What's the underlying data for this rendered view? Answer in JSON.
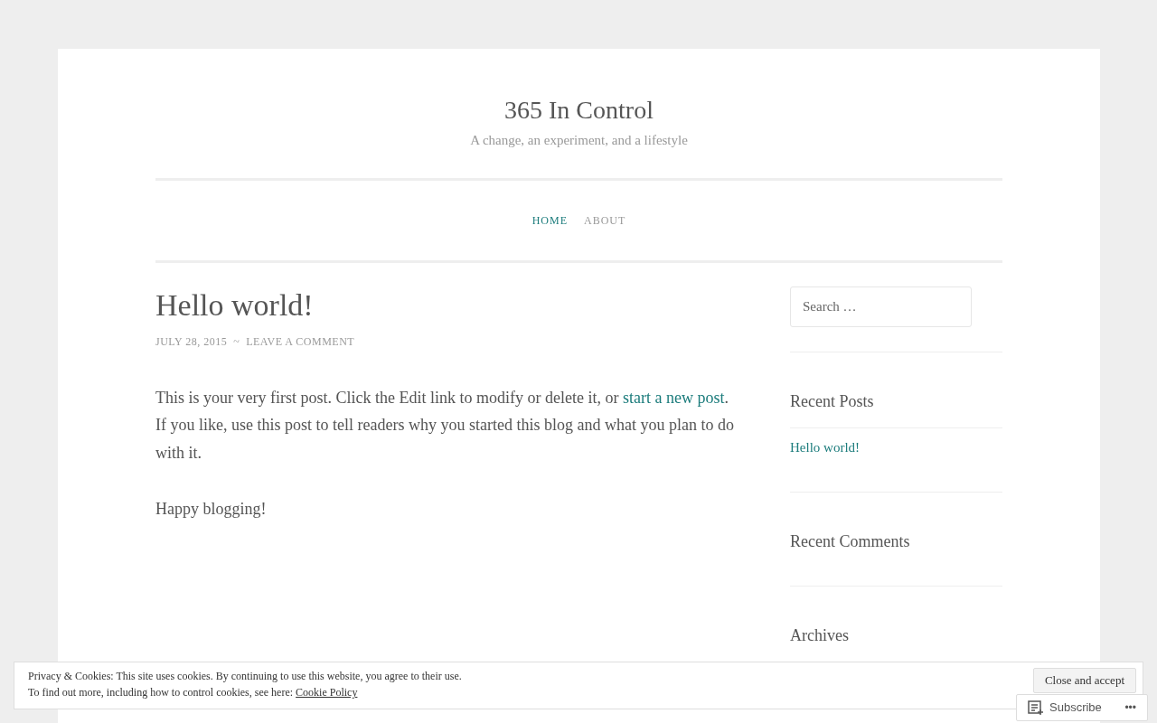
{
  "site": {
    "title": "365 In Control",
    "tagline": "A change, an experiment, and a lifestyle"
  },
  "nav": [
    {
      "label": "HOME",
      "selected": true
    },
    {
      "label": "ABOUT",
      "selected": false
    }
  ],
  "post": {
    "title": "Hello world!",
    "date": "JULY 28, 2015",
    "separator": "~",
    "comment_link": "LEAVE A COMMENT",
    "paragraphs": [
      {
        "before": "This is your very first post. Click the Edit link to modify or delete it, or ",
        "link": "start a new post",
        "after": ". If you like, use this post to tell readers why you started this blog and what you plan to do with it."
      },
      {
        "before": "Happy blogging!"
      }
    ]
  },
  "sidebar": {
    "search": {
      "placeholder": "Search …"
    },
    "widgets": [
      {
        "title": "Recent Posts",
        "links": [
          "Hello world!"
        ]
      },
      {
        "title": "Recent Comments"
      },
      {
        "title": "Archives"
      }
    ]
  },
  "cookie_bar": {
    "line1": "Privacy & Cookies: This site uses cookies. By continuing to use this website, you agree to their use.",
    "line2": "To find out more, including how to control cookies, see here: ",
    "policy_link": "Cookie Policy",
    "button": "Close and accept"
  },
  "subscribe": {
    "label": "Subscribe",
    "more": "•••"
  }
}
